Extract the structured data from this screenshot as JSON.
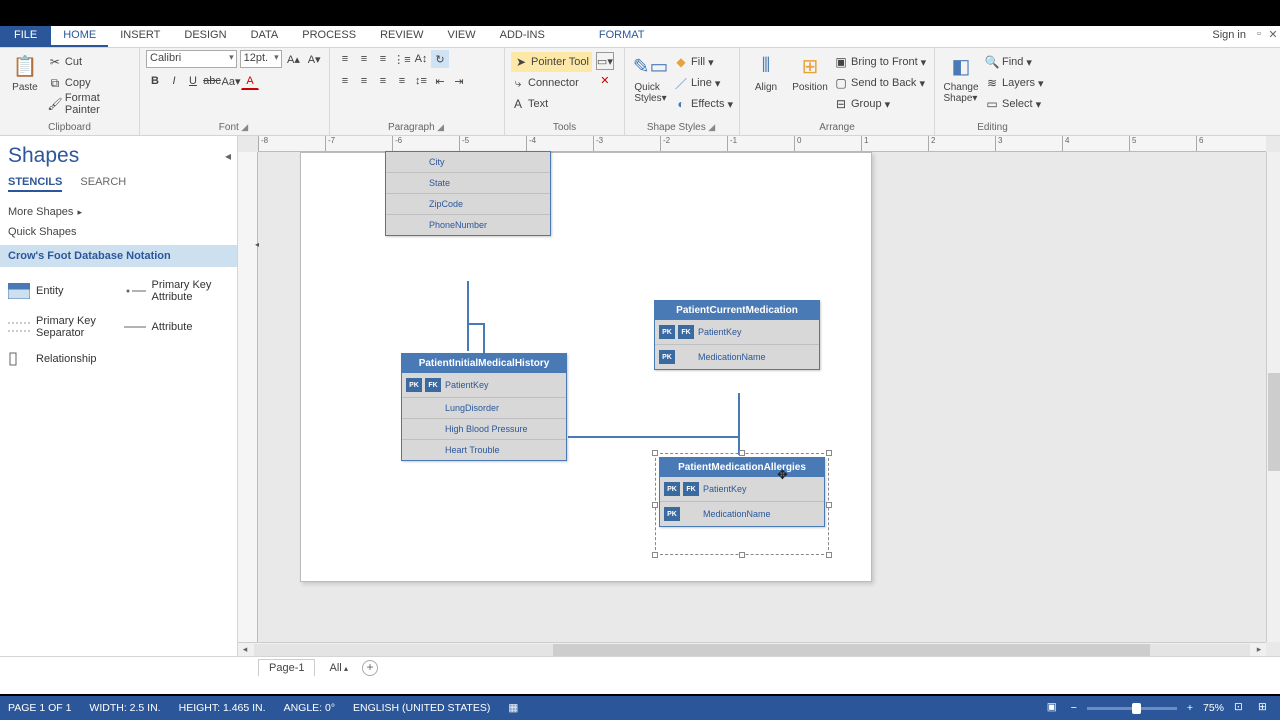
{
  "tabs": {
    "file": "FILE",
    "home": "HOME",
    "insert": "INSERT",
    "design": "DESIGN",
    "data": "DATA",
    "process": "PROCESS",
    "review": "REVIEW",
    "view": "VIEW",
    "addins": "ADD-INS",
    "format": "FORMAT"
  },
  "signin": "Sign in",
  "ribbon": {
    "clipboard": {
      "paste": "Paste",
      "cut": "Cut",
      "copy": "Copy",
      "painter": "Format Painter",
      "label": "Clipboard"
    },
    "font": {
      "name": "Calibri",
      "size": "12pt.",
      "label": "Font"
    },
    "paragraph": {
      "label": "Paragraph"
    },
    "tools": {
      "pointer": "Pointer Tool",
      "connector": "Connector",
      "text": "Text",
      "label": "Tools"
    },
    "shapestyles": {
      "change": "Change Shape",
      "fill": "Fill",
      "line": "Line",
      "effects": "Effects",
      "label": "Shape Styles"
    },
    "arrange": {
      "align": "Align",
      "position": "Position",
      "front": "Bring to Front",
      "back": "Send to Back",
      "group": "Group",
      "label": "Arrange"
    },
    "editing": {
      "change": "Change Shape",
      "find": "Find",
      "layers": "Layers",
      "select": "Select",
      "label": "Editing"
    }
  },
  "shapes": {
    "title": "Shapes",
    "tabs": {
      "stencils": "STENCILS",
      "search": "SEARCH"
    },
    "more": "More Shapes",
    "quick": "Quick Shapes",
    "stencil": "Crow's Foot Database Notation",
    "items": [
      "Entity",
      "Primary Key Attribute",
      "Primary Key Separator",
      "Attribute",
      "Relationship"
    ]
  },
  "canvas": {
    "ruler": [
      "-8",
      "-7",
      "-6",
      "-5",
      "-4",
      "-3",
      "-2",
      "-1",
      "0",
      "1",
      "2",
      "3",
      "4",
      "5",
      "6"
    ],
    "topEntity": {
      "rows": [
        "City",
        "State",
        "ZipCode",
        "PhoneNumber"
      ]
    },
    "history": {
      "title": "PatientInitialMedicalHistory",
      "rows": [
        {
          "pk": true,
          "fk": true,
          "name": "PatientKey"
        },
        {
          "pk": false,
          "fk": false,
          "name": "LungDisorder"
        },
        {
          "pk": false,
          "fk": false,
          "name": "High Blood Pressure"
        },
        {
          "pk": false,
          "fk": false,
          "name": "Heart Trouble"
        }
      ]
    },
    "current": {
      "title": "PatientCurrentMedication",
      "rows": [
        {
          "pk": true,
          "fk": true,
          "name": "PatientKey"
        },
        {
          "pk": true,
          "fk": false,
          "name": "MedicationName"
        }
      ]
    },
    "allergies": {
      "title": "PatientMedicationAllergies",
      "rows": [
        {
          "pk": true,
          "fk": true,
          "name": "PatientKey"
        },
        {
          "pk": true,
          "fk": false,
          "name": "MedicationName"
        }
      ]
    }
  },
  "pagetabs": {
    "page": "Page-1",
    "all": "All"
  },
  "status": {
    "page": "PAGE 1 OF 1",
    "width": "WIDTH: 2.5 IN.",
    "height": "HEIGHT: 1.465 IN.",
    "angle": "ANGLE: 0°",
    "lang": "ENGLISH (UNITED STATES)",
    "zoom": "75%"
  }
}
